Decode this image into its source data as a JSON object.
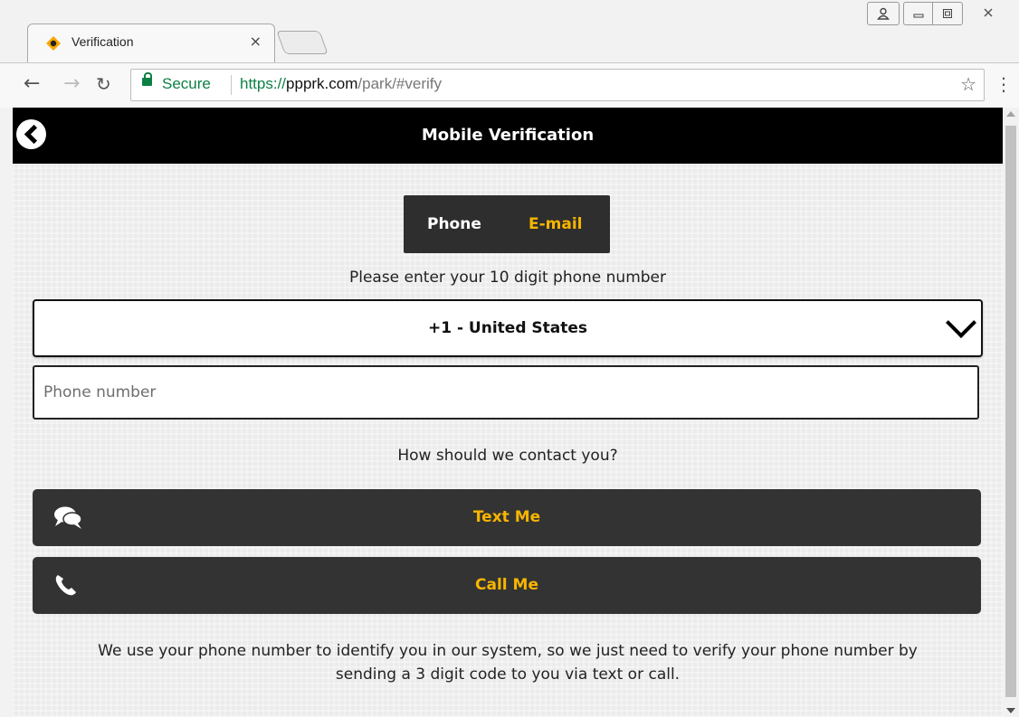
{
  "browser": {
    "tab_title": "Verification",
    "tab_close": "×",
    "security_label": "Secure",
    "url_scheme": "https://",
    "url_host": "ppprk.com",
    "url_path": "/park/#verify"
  },
  "header": {
    "title": "Mobile Verification"
  },
  "toggle": {
    "phone_label": "Phone",
    "email_label": "E-mail"
  },
  "form": {
    "prompt": "Please enter your 10 digit phone number",
    "country_selected": "+1 - United States",
    "phone_placeholder": "Phone number",
    "contact_question": "How should we contact you?"
  },
  "actions": {
    "text_me": "Text Me",
    "call_me": "Call Me"
  },
  "info_text": "We use your phone number to identify you in our system, so we just need to verify your phone number by sending a 3 digit code to you via text or call.",
  "colors": {
    "accent": "#f7b500",
    "button_bg": "#333333",
    "header_bg": "#000000"
  },
  "icons": {
    "back": "back-circle-icon",
    "text": "chat-bubbles-icon",
    "call": "phone-icon",
    "dropdown": "chevron-down-icon"
  }
}
